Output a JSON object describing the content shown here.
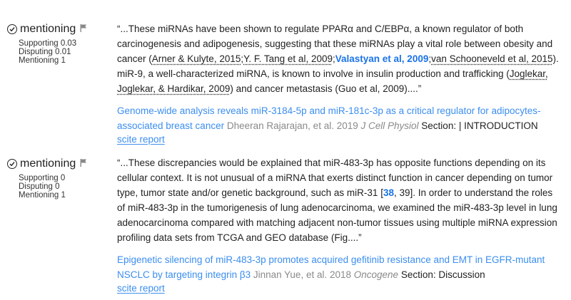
{
  "citations": [
    {
      "type_label": "mentioning",
      "stats": {
        "supporting": "Supporting 0.03",
        "disputing": "Disputing 0.01",
        "mentioning": "Mentioning 1"
      },
      "excerpt": {
        "p1": "“...These miRNAs have been shown to regulate PPARα and C/EBPα, a known regulator of both carcinogenesis and adipogenesis, suggesting that these miRNAs play a vital role between obesity and cancer (",
        "ref1": "Arner & Kulyte, 2015",
        "sep1": ";",
        "ref2": "Y. F. Tang et al, 2009",
        "sep2": ";",
        "ref3": "Valastyan et al, 2009",
        "sep3": ";",
        "ref4": "van Schooneveld et al, 2015",
        "p2": "). miR-9, a well-characterized miRNA, is known to involve in insulin production and trafficking (",
        "ref5": "Joglekar, Joglekar, & Hardikar, 2009",
        "p3": ") and cancer metastasis (Guo et al, 2009)....”"
      },
      "source": {
        "title": "Genome-wide analysis reveals miR-3184-5p and miR-181c-3p as a critical regulator for adipocytes-associated breast cancer",
        "authors": "Dheeran Rajarajan, et al. 2019",
        "journal": "J Cell Physiol",
        "section": "Section: | INTRODUCTION"
      },
      "report_label": "scite report"
    },
    {
      "type_label": "mentioning",
      "stats": {
        "supporting": "Supporting 0",
        "disputing": "Disputing 0",
        "mentioning": "Mentioning 1"
      },
      "excerpt": {
        "p1": "“...These discrepancies would be explained that miR-483-3p has opposite functions depending on its cellular context. It is not unusual of a miRNA that exerts distinct function in cancer depending on tumor type, tumor state and/or genetic background, such as miR-31 [",
        "ref1": "38",
        "p2": ", 39]. In order to understand the roles of miR-483-3p in the tumorigenesis of lung adenocarcinoma, we examined the miR-483-3p level in lung adenocarcinoma compared with matching adjacent non-tumor tissues using multiple miRNA expression profiling data sets from TCGA and GEO database (Fig....”"
      },
      "source": {
        "title": "Epigenetic silencing of miR-483-3p promotes acquired gefitinib resistance and EMT in EGFR-mutant NSCLC by targeting integrin β3",
        "authors": "Jinnan Yue, et al. 2018",
        "journal": "Oncogene",
        "section": "Section: Discussion"
      },
      "report_label": "scite report"
    }
  ]
}
